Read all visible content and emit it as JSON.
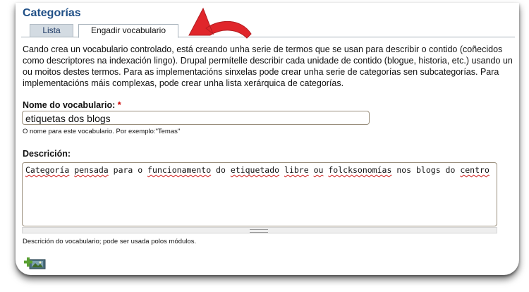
{
  "page": {
    "title": "Categorías",
    "tabs": [
      {
        "label": "Lista"
      },
      {
        "label": "Engadir vocabulario"
      }
    ],
    "description": "Cando crea un vocabulario controlado, está creando unha serie de termos que se usan para describir o contido (coñecidos como descriptores na indexación lingo). Drupal permítelle describir cada unidade de contido (blogue, historia, etc.) usando un ou moitos destes termos. Para as implementacións sinxelas pode crear unha serie de categorías sen subcategorías. Para implementacións máis complexas, pode crear unha lista xerárquica de categorías."
  },
  "form": {
    "name_label": "Nome do vocabulario:",
    "required_mark": "*",
    "name_value": "etiquetas dos blogs",
    "name_help": "O nome para este vocabulario. Por exemplo:\"Temas\"",
    "description_label": "Descrición:",
    "description_words": [
      "Categoría",
      " ",
      "pensada",
      " para o ",
      "funcionamento",
      " do ",
      "etiquetado",
      " ",
      "libre",
      " ",
      "ou",
      " ",
      "folcksonomías",
      " nos blogs do ",
      "centro"
    ],
    "description_help": "Descrición do vocabulario; pode ser usada polos módulos."
  },
  "icons": {
    "arrow": "curved-arrow-icon",
    "image_add": "image-add-icon"
  },
  "colors": {
    "title": "#1f4f86",
    "arrow": "#e0262b",
    "required": "#cc0000"
  }
}
